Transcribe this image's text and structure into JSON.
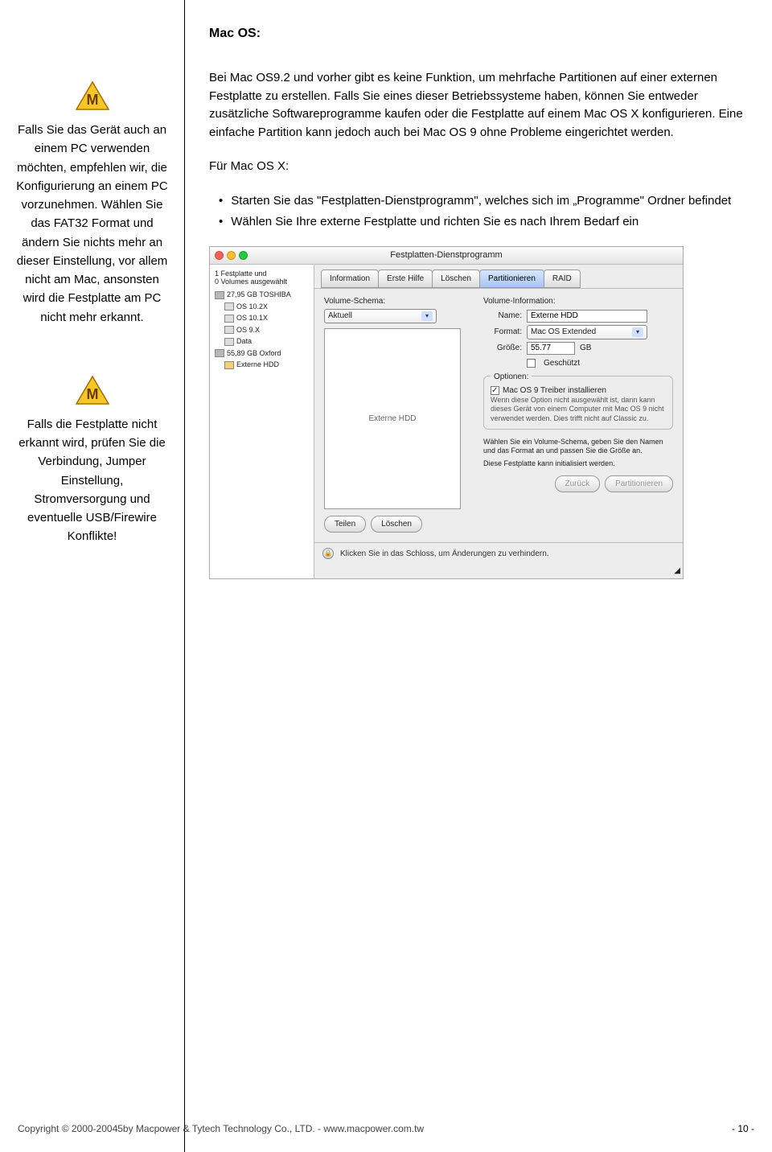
{
  "sidebar": {
    "block1": "Falls Sie das Gerät auch an einem PC verwenden möchten, empfehlen wir, die Konfigurierung an einem PC vorzunehmen. Wählen Sie das FAT32 Format und ändern Sie nichts mehr an dieser Einstellung, vor allem nicht am Mac, ansonsten wird die Festplatte am PC nicht mehr erkannt.",
    "block2": "Falls die Festplatte nicht erkannt wird, prüfen Sie die Verbindung, Jumper Einstellung, Stromversorgung und eventuelle USB/Firewire Konflikte!"
  },
  "main": {
    "heading": "Mac OS:",
    "p1": "Bei Mac OS9.2 und vorher gibt es keine Funktion, um mehrfache Partitionen auf einer externen Festplatte zu erstellen. Falls Sie eines dieser Betriebssysteme haben, können Sie entweder zusätzliche Softwareprogramme kaufen oder die Festplatte auf einem Mac OS X konfigurieren. Eine einfache Partition kann jedoch auch bei Mac OS 9 ohne Probleme eingerichtet werden.",
    "p2label": "Für Mac OS X:",
    "b1": "Starten Sie das \"Festplatten-Dienstprogramm\", welches sich im „Programme\" Ordner befindet",
    "b2": "Wählen Sie Ihre externe Festplatte und richten Sie es nach Ihrem Bedarf ein"
  },
  "shot": {
    "title": "Festplatten-Dienstprogramm",
    "left_hdr1": "1 Festplatte und",
    "left_hdr2": "0 Volumes ausgewählt",
    "dev1": "27,95 GB TOSHIBA",
    "dev1a": "OS 10.2X",
    "dev1b": "OS 10.1X",
    "dev1c": "OS 9.X",
    "dev1d": "Data",
    "dev2": "55,89 GB Oxford",
    "dev2a": "Externe HDD",
    "tabs": {
      "t1": "Information",
      "t2": "Erste Hilfe",
      "t3": "Löschen",
      "t4": "Partitionieren",
      "t5": "RAID"
    },
    "vs_label": "Volume-Schema:",
    "vs_value": "Aktuell",
    "preview": "Externe HDD",
    "vi_label": "Volume-Information:",
    "name_l": "Name:",
    "name_v": "Externe HDD",
    "format_l": "Format:",
    "format_v": "Mac OS Extended",
    "size_l": "Größe:",
    "size_v": "55.77",
    "size_u": "GB",
    "prot": "Geschützt",
    "opt_title": "Optionen:",
    "opt_head": "Mac OS 9 Treiber installieren",
    "opt_body": "Wenn diese Option nicht ausgewählt ist, dann kann dieses Gerät von einem Computer mit Mac OS 9 nicht verwendet werden. Dies trifft nicht auf Classic zu.",
    "hint1": "Wählen Sie ein Volume-Schema, geben Sie den Namen und das Format an und passen Sie die Größe an.",
    "hint2": "Diese Festplatte kann initialisiert werden.",
    "btn_split": "Teilen",
    "btn_del": "Löschen",
    "btn_back": "Zurück",
    "btn_part": "Partitionieren",
    "lock": "Klicken Sie in das Schloss, um Änderungen zu verhindern."
  },
  "footer": {
    "copy": "Copyright © 2000-20045by Macpower & Tytech Technology Co., LTD. - www.macpower.com.tw",
    "page": "- 10 -"
  }
}
